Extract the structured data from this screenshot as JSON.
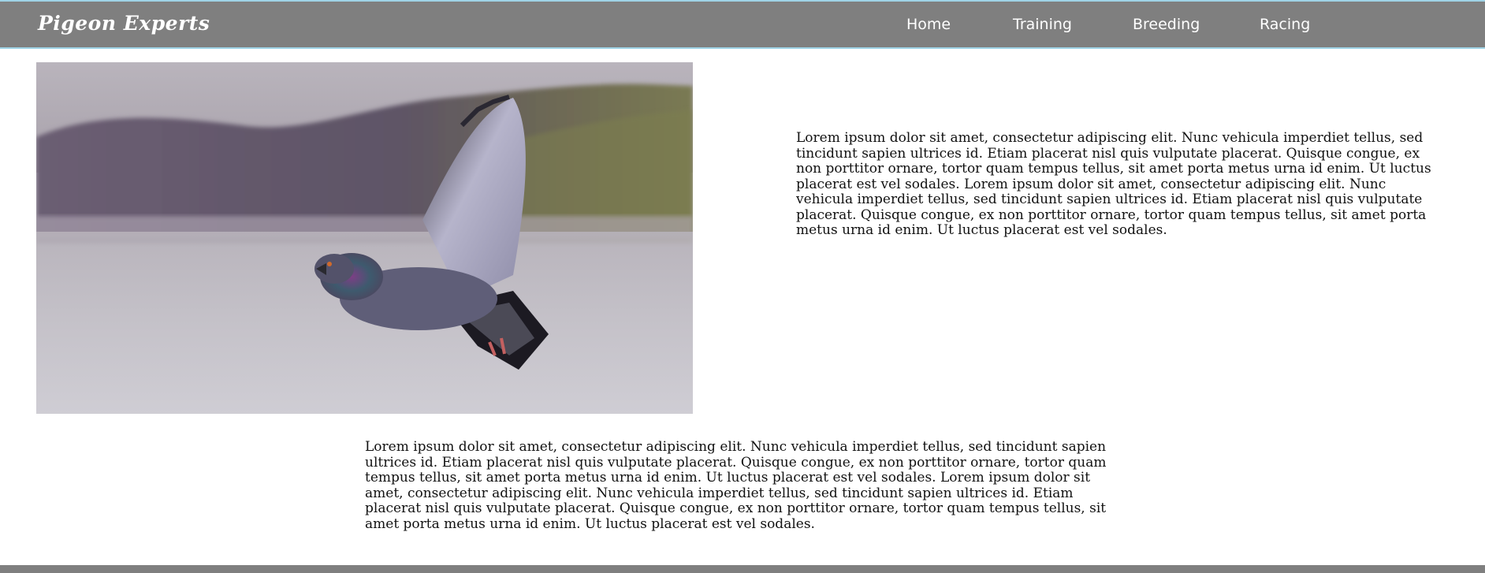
{
  "site": {
    "title": "Pigeon Experts"
  },
  "nav": {
    "items": [
      {
        "label": "Home"
      },
      {
        "label": "Training"
      },
      {
        "label": "Breeding"
      },
      {
        "label": "Racing"
      }
    ]
  },
  "hero_image": {
    "subject": "pigeon in flight over water",
    "icon": "pigeon-photo"
  },
  "content": {
    "paragraph_right": "Lorem ipsum dolor sit amet, consectetur adipiscing elit. Nunc vehicula imperdiet tellus, sed tincidunt sapien ultrices id. Etiam placerat nisl quis vulputate placerat. Quisque congue, ex non porttitor ornare, tortor quam tempus tellus, sit amet porta metus urna id enim. Ut luctus placerat est vel sodales. Lorem ipsum dolor sit amet, consectetur adipiscing elit. Nunc vehicula imperdiet tellus, sed tincidunt sapien ultrices id. Etiam placerat nisl quis vulputate placerat. Quisque congue, ex non porttitor ornare, tortor quam tempus tellus, sit amet porta metus urna id enim. Ut luctus placerat est vel sodales.",
    "paragraph_bottom": "Lorem ipsum dolor sit amet, consectetur adipiscing elit. Nunc vehicula imperdiet tellus, sed tincidunt sapien ultrices id. Etiam placerat nisl quis vulputate placerat. Quisque congue, ex non porttitor ornare, tortor quam tempus tellus, sit amet porta metus urna id enim. Ut luctus placerat est vel sodales. Lorem ipsum dolor sit amet, consectetur adipiscing elit. Nunc vehicula imperdiet tellus, sed tincidunt sapien ultrices id. Etiam placerat nisl quis vulputate placerat. Quisque congue, ex non porttitor ornare, tortor quam tempus tellus, sit amet porta metus urna id enim. Ut luctus placerat est vel sodales."
  },
  "colors": {
    "navbar_bg": "#7f7f7f",
    "navbar_border": "#9fd3e6",
    "text": "#111111",
    "footer_bar": "#7f7f7f"
  }
}
